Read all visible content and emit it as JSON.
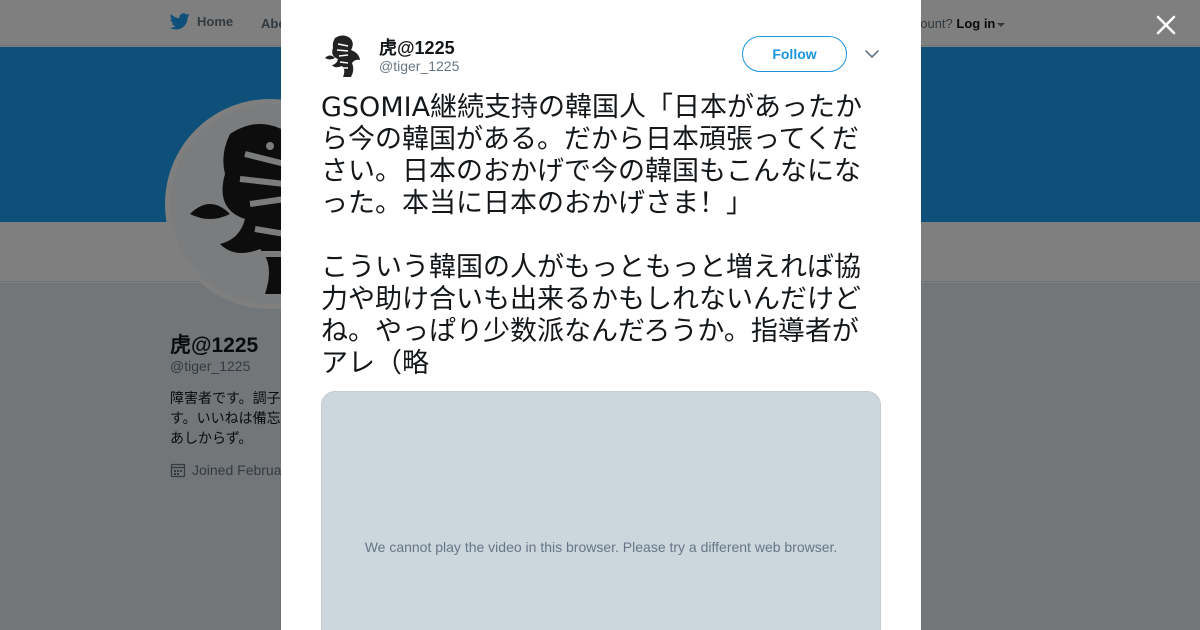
{
  "nav": {
    "home_label": "Home",
    "about_label": "Abo",
    "account_prompt": "account?",
    "login_label": "Log in"
  },
  "profile": {
    "name": "虎@1225",
    "handle": "@tiger_1225",
    "bio_lines": [
      "障害者です。調子",
      "す。いいねは備忘",
      "あしからず。"
    ],
    "joined": "Joined Februa"
  },
  "tweet": {
    "author_name": "虎@1225",
    "author_handle": "@tiger_1225",
    "follow_label": "Follow",
    "text": "GSOMIA継続支持の韓国人「日本があったから今の韓国がある。だから日本頑張ってください。日本のおかげで今の韓国もこんなになった。本当に日本のおかげさま！」\n\nこういう韓国の人がもっともっと増えれば協力や助け合いも出来るかもしれないんだけどね。やっぱり少数派なんだろうか。指導者がアレ（略",
    "media_message": "We cannot play the video in this browser. Please try a different web browser."
  },
  "colors": {
    "brand_blue": "#1da1f2",
    "follow_blue": "#1b95e0",
    "overlay": "rgba(0,0,0,0.5)",
    "media_bg": "#ccd6dd"
  },
  "icons": {
    "twitter": "twitter-bird-icon",
    "close": "close-icon",
    "more": "chevron-down-icon",
    "calendar": "calendar-icon"
  }
}
